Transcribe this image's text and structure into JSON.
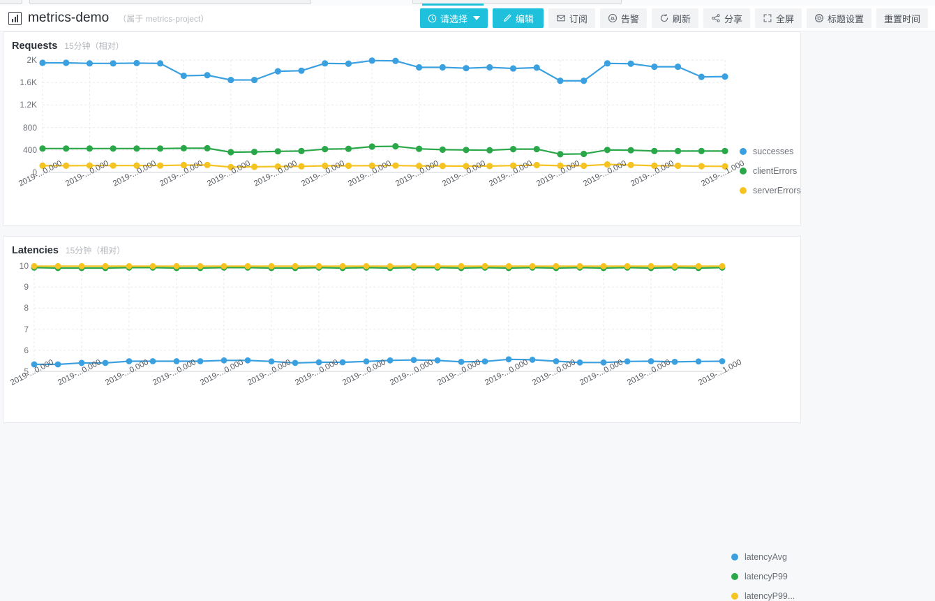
{
  "header": {
    "app_icon": "chart-icon",
    "title": "metrics-demo",
    "subtitle": "（属于 metrics-project）",
    "buttons": [
      {
        "id": "time-picker",
        "label": "请选择",
        "icon": "clock-icon",
        "style": "primary",
        "caret": true
      },
      {
        "id": "edit",
        "label": "编辑",
        "icon": "pencil-icon",
        "style": "primary",
        "caret": false
      },
      {
        "id": "subscribe",
        "label": "订阅",
        "icon": "envelope-icon",
        "style": "default",
        "caret": false
      },
      {
        "id": "alarm",
        "label": "告警",
        "icon": "bell-icon",
        "style": "default",
        "caret": false
      },
      {
        "id": "refresh",
        "label": "刷新",
        "icon": "refresh-icon",
        "style": "default",
        "caret": false
      },
      {
        "id": "share",
        "label": "分享",
        "icon": "share-icon",
        "style": "default",
        "caret": false
      },
      {
        "id": "fullscreen",
        "label": "全屏",
        "icon": "expand-icon",
        "style": "default",
        "caret": false
      },
      {
        "id": "title-settings",
        "label": "标题设置",
        "icon": "gear-icon",
        "style": "default",
        "caret": false
      },
      {
        "id": "reset-time",
        "label": "重置时间",
        "icon": "",
        "style": "default",
        "caret": false
      }
    ]
  },
  "colors": {
    "blue": "#3ba0e0",
    "green": "#2aa849",
    "yellow": "#f5c423",
    "accent": "#1fc0dc",
    "grid": "#e9eaec",
    "card_bg": "#ffffff",
    "page_bg": "#f7f8fa"
  },
  "cards": [
    {
      "id": "requests",
      "title": "Requests",
      "range": "15分钟（相对）"
    },
    {
      "id": "latencies",
      "title": "Latencies",
      "range": "15分钟（相对）"
    }
  ],
  "chart_data": [
    {
      "id": "requests",
      "type": "line",
      "title": "Requests",
      "subtitle": "15分钟（相对）",
      "xlabel": "",
      "ylabel": "",
      "grid": true,
      "legend_position": "right",
      "ylim": [
        0,
        2000
      ],
      "yticks": [
        0,
        400,
        800,
        1200,
        1600,
        2000
      ],
      "ytick_labels": [
        "0",
        "400",
        "800",
        "1.2K",
        "1.6K",
        "2K"
      ],
      "x": [
        0,
        1,
        2,
        3,
        4,
        5,
        6,
        7,
        8,
        9,
        10,
        11,
        12,
        13,
        14,
        15,
        16,
        17,
        18,
        19,
        20,
        21,
        22,
        23,
        24,
        25,
        26,
        27,
        28,
        29
      ],
      "xtick_positions": [
        0,
        2,
        4,
        6,
        8,
        10,
        12,
        14,
        16,
        18,
        20,
        22,
        24,
        26,
        29
      ],
      "xtick_labels": [
        "2019-...0.000",
        "2019-...0.000",
        "2019-...0.000",
        "2019-...0.000",
        "2019-...0.000",
        "2019-...0.000",
        "2019-...0.000",
        "2019-...0.000",
        "2019-...0.000",
        "2019-...0.000",
        "2019-...0.000",
        "2019-...0.000",
        "2019-...0.000",
        "2019-...0.000",
        "2019-...1.000"
      ],
      "series": [
        {
          "name": "successes",
          "color": "#3ba0e0",
          "values": [
            1950,
            1950,
            1940,
            1940,
            1945,
            1940,
            1720,
            1730,
            1645,
            1645,
            1800,
            1810,
            1940,
            1935,
            1990,
            1985,
            1870,
            1870,
            1855,
            1870,
            1850,
            1865,
            1630,
            1630,
            1940,
            1935,
            1880,
            1880,
            1700,
            1705
          ]
        },
        {
          "name": "clientErrors",
          "color": "#2aa849",
          "values": [
            425,
            425,
            425,
            425,
            425,
            425,
            430,
            430,
            360,
            365,
            375,
            380,
            415,
            420,
            460,
            465,
            420,
            405,
            400,
            395,
            415,
            415,
            325,
            330,
            400,
            395,
            380,
            380,
            380,
            380
          ]
        },
        {
          "name": "serverErrors",
          "color": "#f5c423",
          "values": [
            120,
            120,
            122,
            122,
            122,
            122,
            130,
            132,
            95,
            100,
            105,
            108,
            118,
            118,
            120,
            122,
            115,
            115,
            112,
            113,
            122,
            130,
            120,
            118,
            142,
            132,
            120,
            118,
            110,
            108
          ]
        }
      ]
    },
    {
      "id": "latencies",
      "type": "line",
      "title": "Latencies",
      "subtitle": "15分钟（相对）",
      "xlabel": "",
      "ylabel": "",
      "grid": true,
      "legend_position": "right",
      "ylim": [
        5,
        10
      ],
      "yticks": [
        5,
        6,
        7,
        8,
        9,
        10
      ],
      "ytick_labels": [
        "5",
        "6",
        "7",
        "8",
        "9",
        "10"
      ],
      "x": [
        0,
        1,
        2,
        3,
        4,
        5,
        6,
        7,
        8,
        9,
        10,
        11,
        12,
        13,
        14,
        15,
        16,
        17,
        18,
        19,
        20,
        21,
        22,
        23,
        24,
        25,
        26,
        27,
        28,
        29
      ],
      "xtick_positions": [
        0,
        2,
        4,
        6,
        8,
        10,
        12,
        14,
        16,
        18,
        20,
        22,
        24,
        26,
        29
      ],
      "xtick_labels": [
        "2019-...0.000",
        "2019-...0.000",
        "2019-...0.000",
        "2019-...0.000",
        "2019-...0.000",
        "2019-...0.000",
        "2019-...0.000",
        "2019-...0.000",
        "2019-...0.000",
        "2019-...0.000",
        "2019-...0.000",
        "2019-...0.000",
        "2019-...0.000",
        "2019-...0.000",
        "2019-...1.000"
      ],
      "series": [
        {
          "name": "latencyAvg",
          "color": "#3ba0e0",
          "values": [
            5.33,
            5.33,
            5.4,
            5.4,
            5.48,
            5.48,
            5.48,
            5.48,
            5.52,
            5.52,
            5.47,
            5.4,
            5.43,
            5.43,
            5.47,
            5.52,
            5.54,
            5.52,
            5.45,
            5.47,
            5.57,
            5.55,
            5.48,
            5.42,
            5.42,
            5.47,
            5.48,
            5.45,
            5.47,
            5.48
          ]
        },
        {
          "name": "latencyP99",
          "color": "#2aa849",
          "values": [
            9.92,
            9.9,
            9.9,
            9.9,
            9.92,
            9.92,
            9.9,
            9.9,
            9.92,
            9.92,
            9.9,
            9.9,
            9.92,
            9.9,
            9.92,
            9.9,
            9.92,
            9.92,
            9.9,
            9.92,
            9.9,
            9.92,
            9.9,
            9.92,
            9.9,
            9.92,
            9.9,
            9.92,
            9.9,
            9.92
          ]
        },
        {
          "name": "latencyP99...",
          "color": "#f5c423",
          "values": [
            9.99,
            9.99,
            9.99,
            9.99,
            9.99,
            9.99,
            9.99,
            9.99,
            9.99,
            9.99,
            9.99,
            9.99,
            9.99,
            9.99,
            9.99,
            9.99,
            9.99,
            9.99,
            9.99,
            9.99,
            9.99,
            9.99,
            9.99,
            9.99,
            9.99,
            9.99,
            9.99,
            9.99,
            9.99,
            9.99
          ]
        }
      ]
    }
  ]
}
